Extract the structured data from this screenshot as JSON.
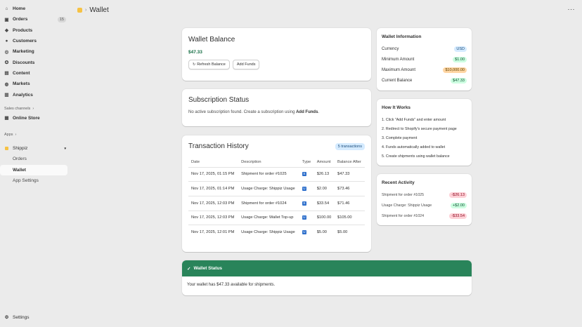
{
  "sidebar": {
    "items": [
      {
        "label": "Home",
        "icon": "home-icon"
      },
      {
        "label": "Orders",
        "icon": "orders-icon",
        "badge": "15"
      },
      {
        "label": "Products",
        "icon": "tag-icon"
      },
      {
        "label": "Customers",
        "icon": "person-icon"
      },
      {
        "label": "Marketing",
        "icon": "target-icon"
      },
      {
        "label": "Discounts",
        "icon": "discount-icon"
      },
      {
        "label": "Content",
        "icon": "content-icon"
      },
      {
        "label": "Markets",
        "icon": "globe-icon"
      },
      {
        "label": "Analytics",
        "icon": "bar-chart-icon"
      }
    ],
    "sales_channels_label": "Sales channels",
    "online_store_label": "Online Store",
    "apps_label": "Apps",
    "app_name": "Shippiz",
    "app_sub_items": [
      "Orders",
      "Wallet"
    ],
    "app_settings_label": "App Settings",
    "settings_label": "Settings"
  },
  "header": {
    "title": "Wallet",
    "more": "···"
  },
  "wallet_balance": {
    "title": "Wallet Balance",
    "amount": "$47.33",
    "refresh_label": "Refresh Balance",
    "add_funds_label": "Add Funds"
  },
  "subscription": {
    "title": "Subscription Status",
    "message": "No active subscription found. Create a subscription using ",
    "link": "Add Funds",
    "suffix": "."
  },
  "transactions": {
    "title": "Transaction History",
    "count": "5 transactions",
    "columns": [
      "Date",
      "Description",
      "Type",
      "Amount",
      "Balance After"
    ],
    "rows": [
      {
        "date": "Nov 17, 2025, 01:15 PM",
        "description": "Shipment for order #1025",
        "type": "S",
        "amount": "$26.13",
        "balance": "$47.33"
      },
      {
        "date": "Nov 17, 2025, 01:14 PM",
        "description": "Usage Charge: Shippiz Usage",
        "type": "U",
        "amount": "$2.00",
        "balance": "$73.46"
      },
      {
        "date": "Nov 17, 2025, 12:03 PM",
        "description": "Shipment for order #1024",
        "type": "S",
        "amount": "$33.54",
        "balance": "$71.46"
      },
      {
        "date": "Nov 17, 2025, 12:03 PM",
        "description": "Usage Charge: Wallet Top-up",
        "type": "U",
        "amount": "$100.00",
        "balance": "$105.00"
      },
      {
        "date": "Nov 17, 2025, 12:01 PM",
        "description": "Usage Charge: Shippiz Usage",
        "type": "U",
        "amount": "$5.00",
        "balance": "$5.00"
      }
    ]
  },
  "wallet_status": {
    "title": "Wallet Status",
    "message": "Your wallet has $47.33 available for shipments."
  },
  "wallet_info": {
    "title": "Wallet Information",
    "rows": [
      {
        "label": "Currency",
        "value": "USD",
        "tone": "blue"
      },
      {
        "label": "Minimum Amount",
        "value": "$1.00",
        "tone": "green"
      },
      {
        "label": "Maximum Amount",
        "value": "$10,000.00",
        "tone": "orange"
      },
      {
        "label": "Current Balance",
        "value": "$47.33",
        "tone": "green"
      }
    ]
  },
  "how_it_works": {
    "title": "How It Works",
    "steps": [
      "1. Click \"Add Funds\" and enter amount",
      "2. Redirect to Shopify's secure payment page",
      "3. Complete payment",
      "4. Funds automatically added to wallet",
      "5. Create shipments using wallet balance"
    ]
  },
  "recent_activity": {
    "title": "Recent Activity",
    "rows": [
      {
        "label": "Shipment for order #1025",
        "value": "-$26.13",
        "tone": "red"
      },
      {
        "label": "Usage Charge: Shippiz Usage",
        "value": "+$2.00",
        "tone": "green"
      },
      {
        "label": "Shipment for order #1024",
        "value": "-$33.54",
        "tone": "red"
      }
    ]
  },
  "colors": {
    "accent_green": "#29845a",
    "balance_green": "#136c42",
    "info_blue": "#d5ebff"
  }
}
